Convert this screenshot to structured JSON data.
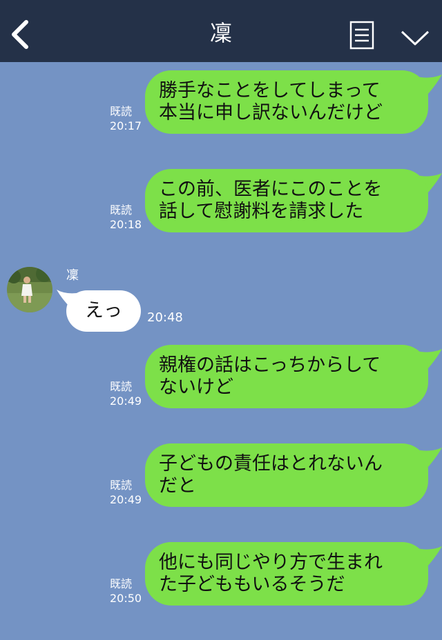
{
  "header": {
    "back_icon": "chevron-left-icon",
    "title": "凜",
    "menu_icon": "document-lines-icon",
    "collapse_icon": "chevron-down-icon",
    "background": "#243148"
  },
  "chat": {
    "background": "#7493c4",
    "sent_bubble_color": "#7de049",
    "received_bubble_color": "#ffffff",
    "messages": [
      {
        "from": "me",
        "read": "既読",
        "time": "20:17",
        "text": "勝手なことをしてしまって\n本当に申し訳ないんだけど"
      },
      {
        "from": "me",
        "read": "既読",
        "time": "20:18",
        "text": "この前、医者にこのことを\n話して慰謝料を請求した"
      },
      {
        "from": "凜",
        "sender_name": "凜",
        "time": "20:48",
        "text": "えっ"
      },
      {
        "from": "me",
        "read": "既読",
        "time": "20:49",
        "text": "親権の話はこっちからして\nないけど"
      },
      {
        "from": "me",
        "read": "既読",
        "time": "20:49",
        "text": "子どもの責任はとれないん\nだと"
      },
      {
        "from": "me",
        "read": "既読",
        "time": "20:50",
        "text": "他にも同じやり方で生まれ\nた子どももいるそうだ"
      }
    ]
  }
}
